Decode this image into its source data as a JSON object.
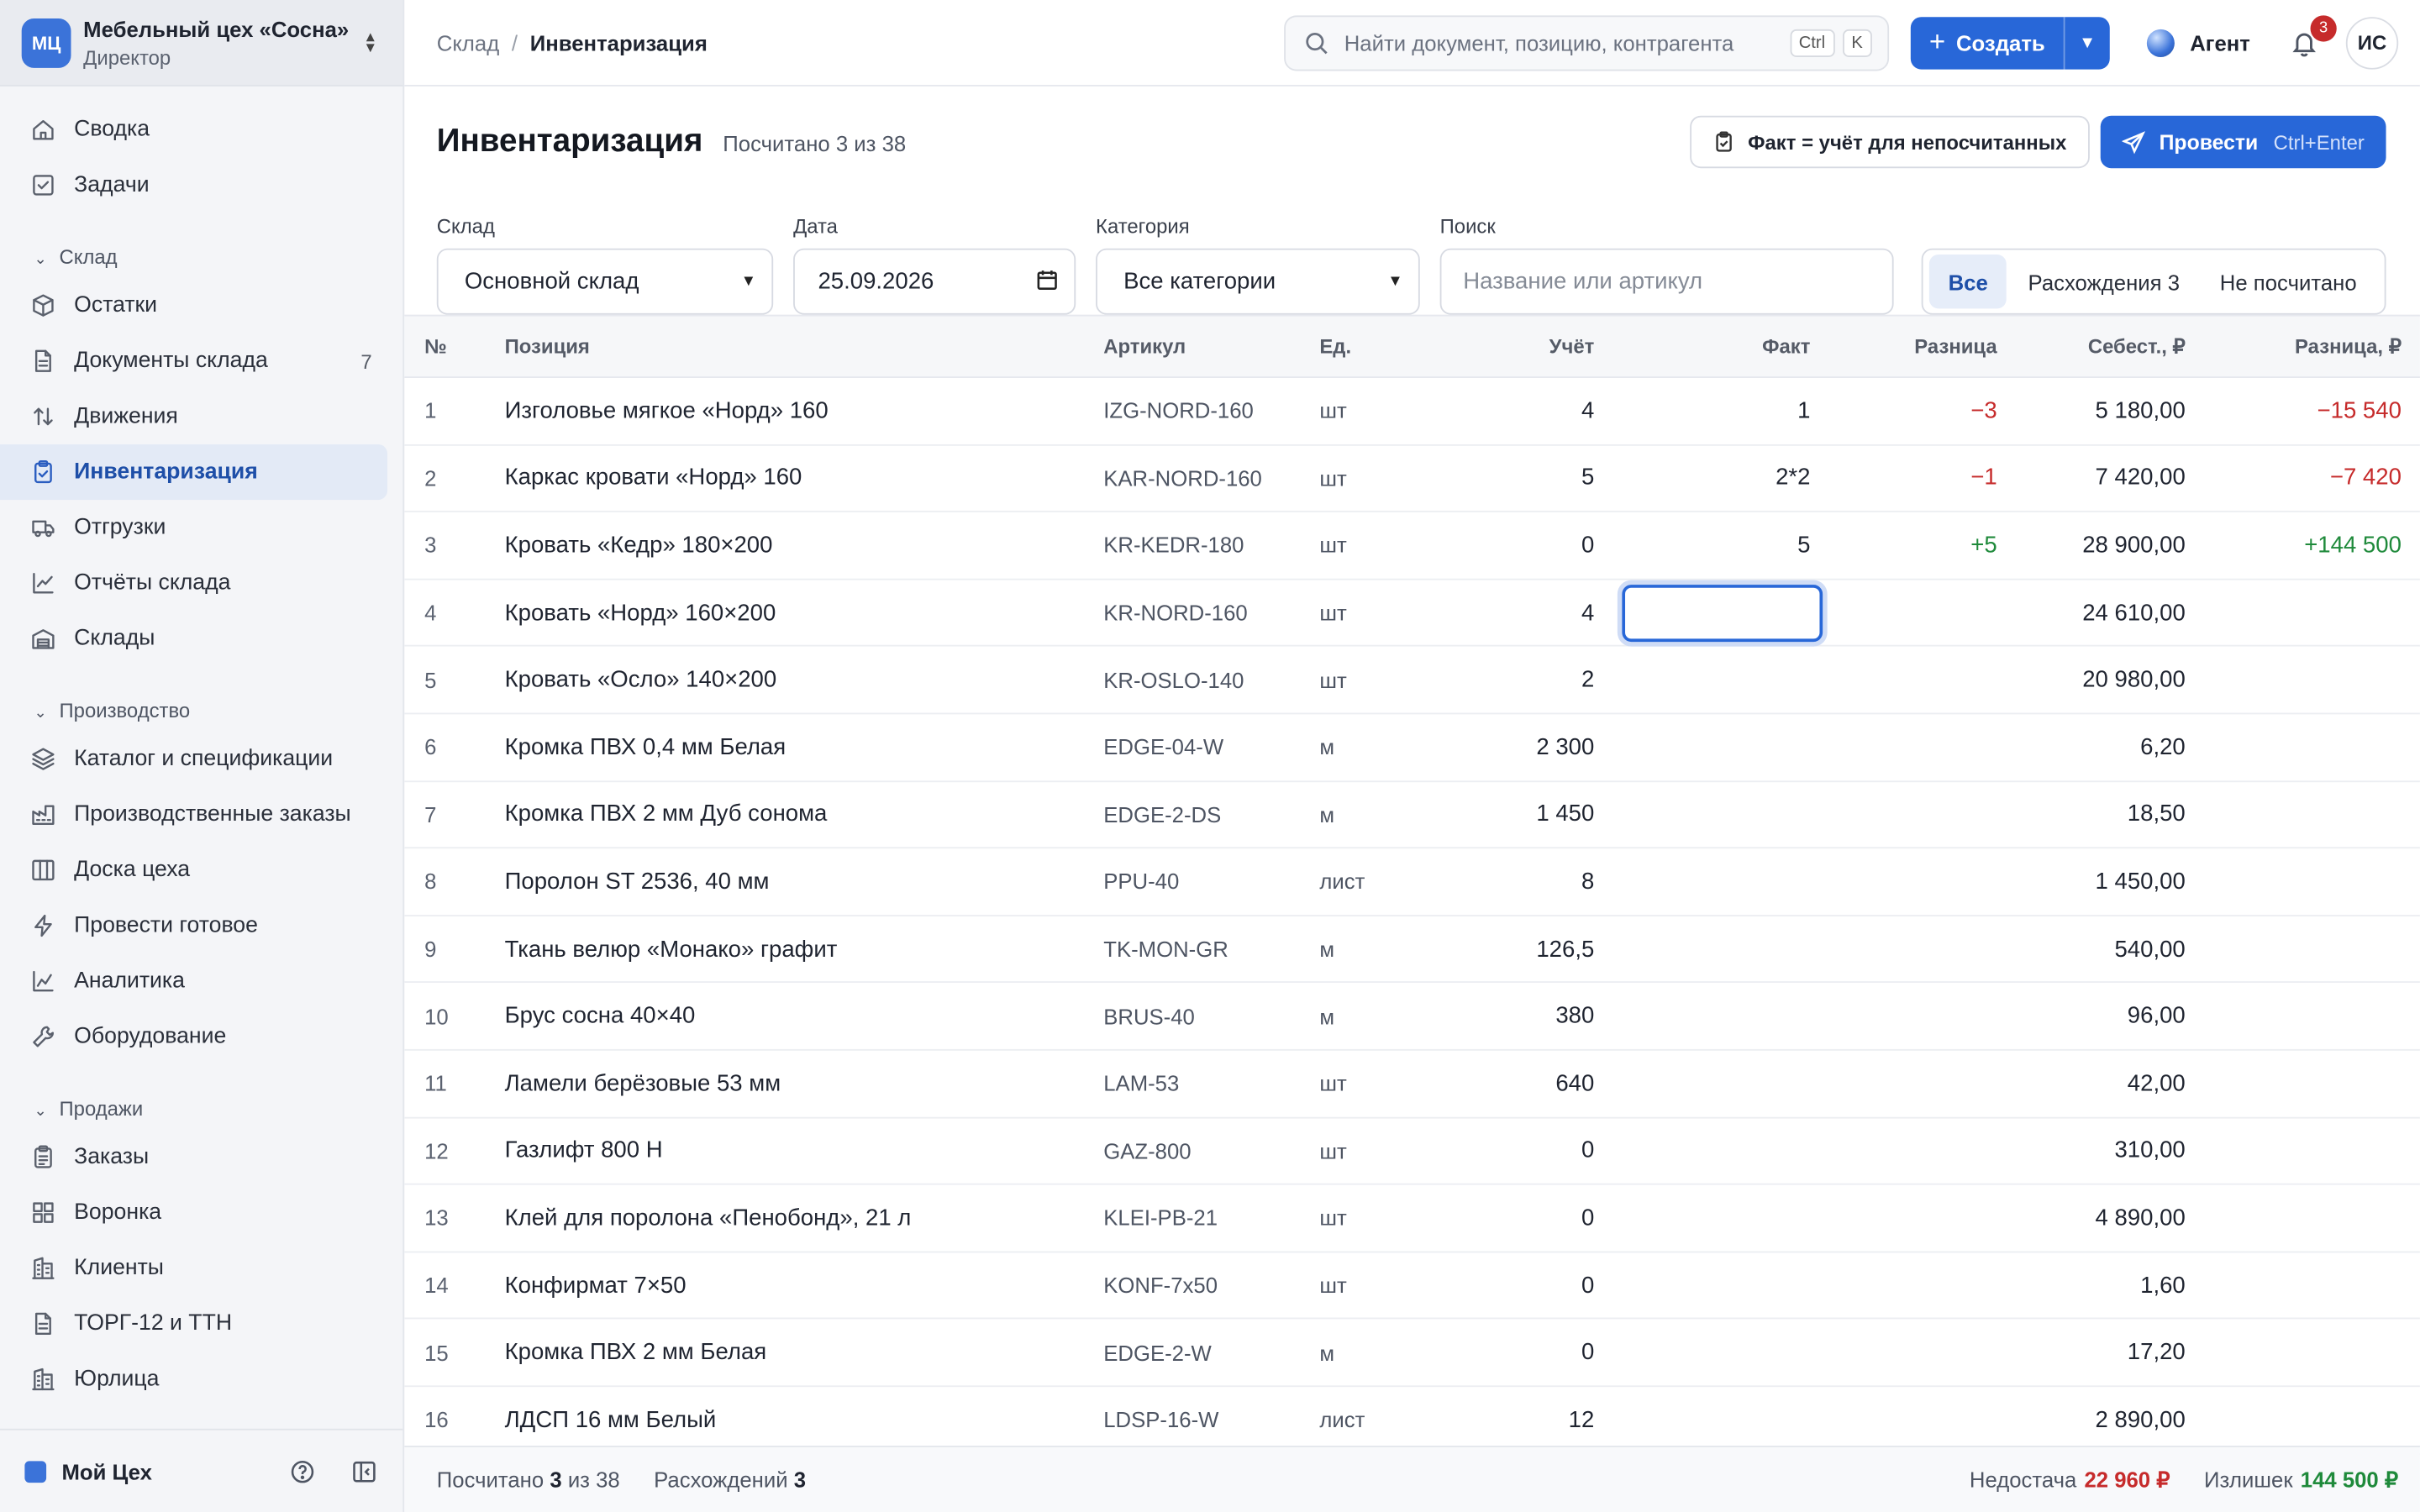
{
  "org": {
    "logo": "МЦ",
    "name": "Мебельный цех «Сосна»",
    "role": "Директор"
  },
  "nav": {
    "top": [
      {
        "label": "Сводка",
        "icon": "home-icon"
      },
      {
        "label": "Задачи",
        "icon": "task-icon"
      }
    ],
    "sections": [
      {
        "title": "Склад",
        "items": [
          {
            "label": "Остатки",
            "icon": "box-icon"
          },
          {
            "label": "Документы склада",
            "icon": "document-icon",
            "count": "7"
          },
          {
            "label": "Движения",
            "icon": "arrows-icon"
          },
          {
            "label": "Инвентаризация",
            "icon": "clipboard-icon",
            "active": true
          },
          {
            "label": "Отгрузки",
            "icon": "truck-icon"
          },
          {
            "label": "Отчёты склада",
            "icon": "line-chart-icon"
          },
          {
            "label": "Склады",
            "icon": "warehouse-icon"
          }
        ]
      },
      {
        "title": "Производство",
        "items": [
          {
            "label": "Каталог и спецификации",
            "icon": "layers-icon"
          },
          {
            "label": "Производственные заказы",
            "icon": "factory-icon"
          },
          {
            "label": "Доска цеха",
            "icon": "columns-icon"
          },
          {
            "label": "Провести готовое",
            "icon": "bolt-icon"
          },
          {
            "label": "Аналитика",
            "icon": "analytics-icon"
          },
          {
            "label": "Оборудование",
            "icon": "wrench-icon"
          }
        ]
      },
      {
        "title": "Продажи",
        "items": [
          {
            "label": "Заказы",
            "icon": "clipboard-list-icon"
          },
          {
            "label": "Воронка",
            "icon": "grid-icon"
          },
          {
            "label": "Клиенты",
            "icon": "building-icon"
          },
          {
            "label": "ТОРГ-12 и ТТН",
            "icon": "document-icon"
          },
          {
            "label": "Юрлица",
            "icon": "building-icon"
          }
        ]
      }
    ],
    "footer": {
      "workspace": "Мой Цех"
    }
  },
  "topbar": {
    "breadcrumb_parent": "Склад",
    "breadcrumb_sep": "/",
    "breadcrumb_current": "Инвентаризация",
    "search_placeholder": "Найти документ, позицию, контрагента",
    "kbd1": "Ctrl",
    "kbd2": "K",
    "create_label": "Создать",
    "agent_label": "Агент",
    "notifications": "3",
    "user_initials": "ИС"
  },
  "page": {
    "title": "Инвентаризация",
    "subtitle": "Посчитано 3 из 38",
    "fact_button": "Факт = учёт для непосчитанных",
    "post_button": "Провести",
    "post_hint": "Ctrl+Enter"
  },
  "filters": {
    "warehouse_label": "Склад",
    "warehouse_value": "Основной склад",
    "date_label": "Дата",
    "date_value": "25.09.2026",
    "category_label": "Категория",
    "category_value": "Все категории",
    "search_label": "Поиск",
    "search_placeholder": "Название или артикул",
    "seg_all": "Все",
    "seg_diff": "Расхождения 3",
    "seg_uncounted": "Не посчитано"
  },
  "table": {
    "headers": {
      "no": "№",
      "name": "Позиция",
      "sku": "Артикул",
      "unit": "Ед.",
      "accounted": "Учёт",
      "fact": "Факт",
      "diff": "Разница",
      "cost": "Себест., ₽",
      "diff_rub": "Разница, ₽"
    },
    "rows": [
      {
        "no": "1",
        "name": "Изголовье мягкое «Норд» 160",
        "sku": "IZG-NORD-160",
        "unit": "шт",
        "accounted": "4",
        "fact": "1",
        "diff": "−3",
        "diff_type": "neg",
        "cost": "5 180,00",
        "diff_rub": "−15 540"
      },
      {
        "no": "2",
        "name": "Каркас кровати «Норд» 160",
        "sku": "KAR-NORD-160",
        "unit": "шт",
        "accounted": "5",
        "fact": "2*2",
        "diff": "−1",
        "diff_type": "neg",
        "cost": "7 420,00",
        "diff_rub": "−7 420"
      },
      {
        "no": "3",
        "name": "Кровать «Кедр» 180×200",
        "sku": "KR-KEDR-180",
        "unit": "шт",
        "accounted": "0",
        "fact": "5",
        "diff": "+5",
        "diff_type": "pos",
        "cost": "28 900,00",
        "diff_rub": "+144 500"
      },
      {
        "no": "4",
        "name": "Кровать «Норд» 160×200",
        "sku": "KR-NORD-160",
        "unit": "шт",
        "accounted": "4",
        "fact": "",
        "editing": true,
        "diff": "",
        "diff_type": "",
        "cost": "24 610,00",
        "diff_rub": ""
      },
      {
        "no": "5",
        "name": "Кровать «Осло» 140×200",
        "sku": "KR-OSLO-140",
        "unit": "шт",
        "accounted": "2",
        "fact": "",
        "diff": "",
        "diff_type": "",
        "cost": "20 980,00",
        "diff_rub": ""
      },
      {
        "no": "6",
        "name": "Кромка ПВХ 0,4 мм Белая",
        "sku": "EDGE-04-W",
        "unit": "м",
        "accounted": "2 300",
        "fact": "",
        "diff": "",
        "diff_type": "",
        "cost": "6,20",
        "diff_rub": ""
      },
      {
        "no": "7",
        "name": "Кромка ПВХ 2 мм Дуб сонома",
        "sku": "EDGE-2-DS",
        "unit": "м",
        "accounted": "1 450",
        "fact": "",
        "diff": "",
        "diff_type": "",
        "cost": "18,50",
        "diff_rub": ""
      },
      {
        "no": "8",
        "name": "Поролон ST 2536, 40 мм",
        "sku": "PPU-40",
        "unit": "лист",
        "accounted": "8",
        "fact": "",
        "diff": "",
        "diff_type": "",
        "cost": "1 450,00",
        "diff_rub": ""
      },
      {
        "no": "9",
        "name": "Ткань велюр «Монако» графит",
        "sku": "TK-MON-GR",
        "unit": "м",
        "accounted": "126,5",
        "fact": "",
        "diff": "",
        "diff_type": "",
        "cost": "540,00",
        "diff_rub": ""
      },
      {
        "no": "10",
        "name": "Брус сосна 40×40",
        "sku": "BRUS-40",
        "unit": "м",
        "accounted": "380",
        "fact": "",
        "diff": "",
        "diff_type": "",
        "cost": "96,00",
        "diff_rub": ""
      },
      {
        "no": "11",
        "name": "Ламели берёзовые 53 мм",
        "sku": "LAM-53",
        "unit": "шт",
        "accounted": "640",
        "fact": "",
        "diff": "",
        "diff_type": "",
        "cost": "42,00",
        "diff_rub": ""
      },
      {
        "no": "12",
        "name": "Газлифт 800 Н",
        "sku": "GAZ-800",
        "unit": "шт",
        "accounted": "0",
        "fact": "",
        "diff": "",
        "diff_type": "",
        "cost": "310,00",
        "diff_rub": ""
      },
      {
        "no": "13",
        "name": "Клей для поролона «Пенобонд», 21 л",
        "sku": "KLEI-PB-21",
        "unit": "шт",
        "accounted": "0",
        "fact": "",
        "diff": "",
        "diff_type": "",
        "cost": "4 890,00",
        "diff_rub": ""
      },
      {
        "no": "14",
        "name": "Конфирмат 7×50",
        "sku": "KONF-7x50",
        "unit": "шт",
        "accounted": "0",
        "fact": "",
        "diff": "",
        "diff_type": "",
        "cost": "1,60",
        "diff_rub": ""
      },
      {
        "no": "15",
        "name": "Кромка ПВХ 2 мм Белая",
        "sku": "EDGE-2-W",
        "unit": "м",
        "accounted": "0",
        "fact": "",
        "diff": "",
        "diff_type": "",
        "cost": "17,20",
        "diff_rub": ""
      },
      {
        "no": "16",
        "name": "ЛДСП 16 мм Белый",
        "sku": "LDSP-16-W",
        "unit": "лист",
        "accounted": "12",
        "fact": "",
        "diff": "",
        "diff_type": "",
        "cost": "2 890,00",
        "diff_rub": ""
      }
    ]
  },
  "summary": {
    "counted_prefix": "Посчитано",
    "counted_value": "3",
    "counted_suffix": "из 38",
    "diff_label": "Расхождений",
    "diff_value": "3",
    "shortage_label": "Недостача",
    "shortage_value": "22 960 ₽",
    "surplus_label": "Излишек",
    "surplus_value": "144 500 ₽"
  },
  "colors": {
    "accent": "#2867d8",
    "negative": "#c62b2b",
    "positive": "#1f8a3b",
    "sidebar_bg": "#f4f5f8"
  }
}
